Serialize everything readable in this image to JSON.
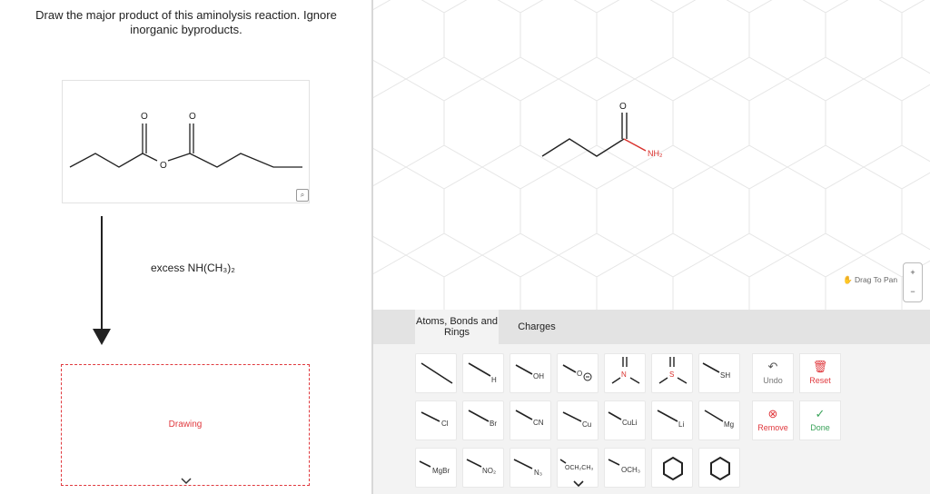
{
  "question": {
    "text": "Draw the major product of this aminolysis reaction. Ignore inorganic byproducts."
  },
  "reactant": {
    "atom_o1": "O",
    "atom_o2": "O",
    "atom_o3": "O",
    "zoom_icon": "magnifier-icon"
  },
  "reaction": {
    "reagent": "excess NH(CH₃)₂"
  },
  "product": {
    "placeholder": "Drawing",
    "expand_icon": "chevron-down-icon"
  },
  "canvas": {
    "atom_o": "O",
    "atom_nh2": "NH₂",
    "pan_label": "Drag To Pan",
    "zoom_in": "+",
    "zoom_out": "−"
  },
  "tabs": [
    "Atoms, Bonds and Rings",
    "Charges"
  ],
  "tools": {
    "row1": [
      "",
      "H",
      "OH",
      "O",
      "N",
      "S",
      "SH"
    ],
    "row2": [
      "Cl",
      "Br",
      "CN",
      "Cu",
      "CuLi",
      "Li",
      "Mg"
    ],
    "row3": [
      "MgBr",
      "NO₂",
      "N₃",
      "OCH₂CH₃",
      "OCH₃",
      "",
      ""
    ]
  },
  "actions": {
    "undo": "Undo",
    "reset": "Reset",
    "remove": "Remove",
    "done": "Done"
  },
  "colors": {
    "accent": "#e0393e",
    "done": "#3aa35a",
    "oxygen": "#d9302c",
    "nitrogen": "#d9302c"
  }
}
